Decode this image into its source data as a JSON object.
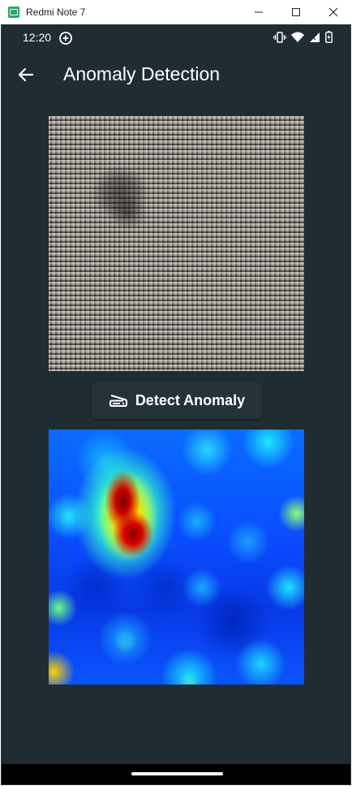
{
  "window": {
    "title": "Redmi Note 7",
    "logo_color": "#2fa36b",
    "controls": [
      "minimize-icon",
      "maximize-icon",
      "close-icon"
    ]
  },
  "status_bar": {
    "time": "12:20",
    "left_icon": "add-circle-icon",
    "right_icons": [
      "vibrate-icon",
      "wifi-icon",
      "signal-icon",
      "battery-charging-icon"
    ]
  },
  "app_bar": {
    "back_icon": "back-arrow-icon",
    "title": "Anomaly Detection"
  },
  "main": {
    "input_image": "fabric-texture-image",
    "detect_button": {
      "icon": "scanner-icon",
      "label": "Detect Anomaly"
    },
    "output_image": "anomaly-heatmap-image"
  },
  "colors": {
    "background": "#1f2d32",
    "button_background": "#243338",
    "text": "#ffffff"
  }
}
